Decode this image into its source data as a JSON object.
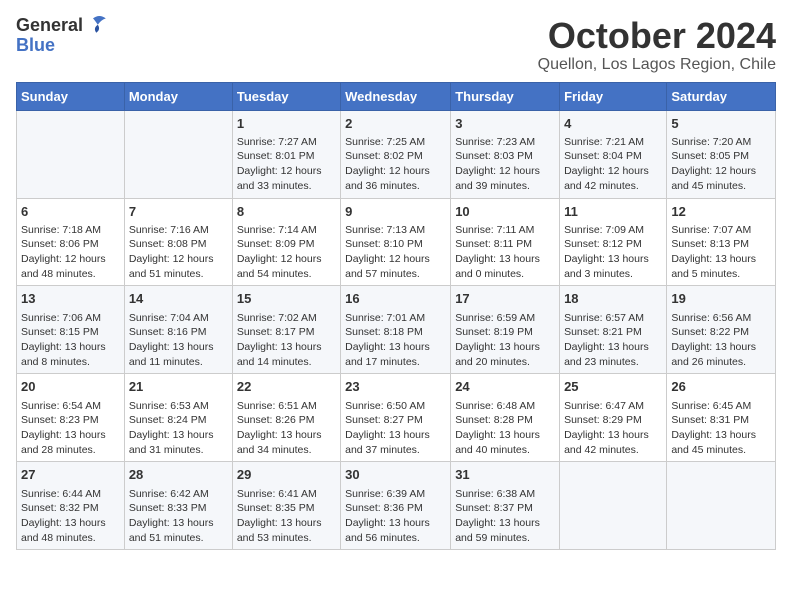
{
  "header": {
    "logo_general": "General",
    "logo_blue": "Blue",
    "title": "October 2024",
    "subtitle": "Quellon, Los Lagos Region, Chile"
  },
  "days_of_week": [
    "Sunday",
    "Monday",
    "Tuesday",
    "Wednesday",
    "Thursday",
    "Friday",
    "Saturday"
  ],
  "weeks": [
    [
      {
        "day": "",
        "content": ""
      },
      {
        "day": "",
        "content": ""
      },
      {
        "day": "1",
        "content": "Sunrise: 7:27 AM\nSunset: 8:01 PM\nDaylight: 12 hours and 33 minutes."
      },
      {
        "day": "2",
        "content": "Sunrise: 7:25 AM\nSunset: 8:02 PM\nDaylight: 12 hours and 36 minutes."
      },
      {
        "day": "3",
        "content": "Sunrise: 7:23 AM\nSunset: 8:03 PM\nDaylight: 12 hours and 39 minutes."
      },
      {
        "day": "4",
        "content": "Sunrise: 7:21 AM\nSunset: 8:04 PM\nDaylight: 12 hours and 42 minutes."
      },
      {
        "day": "5",
        "content": "Sunrise: 7:20 AM\nSunset: 8:05 PM\nDaylight: 12 hours and 45 minutes."
      }
    ],
    [
      {
        "day": "6",
        "content": "Sunrise: 7:18 AM\nSunset: 8:06 PM\nDaylight: 12 hours and 48 minutes."
      },
      {
        "day": "7",
        "content": "Sunrise: 7:16 AM\nSunset: 8:08 PM\nDaylight: 12 hours and 51 minutes."
      },
      {
        "day": "8",
        "content": "Sunrise: 7:14 AM\nSunset: 8:09 PM\nDaylight: 12 hours and 54 minutes."
      },
      {
        "day": "9",
        "content": "Sunrise: 7:13 AM\nSunset: 8:10 PM\nDaylight: 12 hours and 57 minutes."
      },
      {
        "day": "10",
        "content": "Sunrise: 7:11 AM\nSunset: 8:11 PM\nDaylight: 13 hours and 0 minutes."
      },
      {
        "day": "11",
        "content": "Sunrise: 7:09 AM\nSunset: 8:12 PM\nDaylight: 13 hours and 3 minutes."
      },
      {
        "day": "12",
        "content": "Sunrise: 7:07 AM\nSunset: 8:13 PM\nDaylight: 13 hours and 5 minutes."
      }
    ],
    [
      {
        "day": "13",
        "content": "Sunrise: 7:06 AM\nSunset: 8:15 PM\nDaylight: 13 hours and 8 minutes."
      },
      {
        "day": "14",
        "content": "Sunrise: 7:04 AM\nSunset: 8:16 PM\nDaylight: 13 hours and 11 minutes."
      },
      {
        "day": "15",
        "content": "Sunrise: 7:02 AM\nSunset: 8:17 PM\nDaylight: 13 hours and 14 minutes."
      },
      {
        "day": "16",
        "content": "Sunrise: 7:01 AM\nSunset: 8:18 PM\nDaylight: 13 hours and 17 minutes."
      },
      {
        "day": "17",
        "content": "Sunrise: 6:59 AM\nSunset: 8:19 PM\nDaylight: 13 hours and 20 minutes."
      },
      {
        "day": "18",
        "content": "Sunrise: 6:57 AM\nSunset: 8:21 PM\nDaylight: 13 hours and 23 minutes."
      },
      {
        "day": "19",
        "content": "Sunrise: 6:56 AM\nSunset: 8:22 PM\nDaylight: 13 hours and 26 minutes."
      }
    ],
    [
      {
        "day": "20",
        "content": "Sunrise: 6:54 AM\nSunset: 8:23 PM\nDaylight: 13 hours and 28 minutes."
      },
      {
        "day": "21",
        "content": "Sunrise: 6:53 AM\nSunset: 8:24 PM\nDaylight: 13 hours and 31 minutes."
      },
      {
        "day": "22",
        "content": "Sunrise: 6:51 AM\nSunset: 8:26 PM\nDaylight: 13 hours and 34 minutes."
      },
      {
        "day": "23",
        "content": "Sunrise: 6:50 AM\nSunset: 8:27 PM\nDaylight: 13 hours and 37 minutes."
      },
      {
        "day": "24",
        "content": "Sunrise: 6:48 AM\nSunset: 8:28 PM\nDaylight: 13 hours and 40 minutes."
      },
      {
        "day": "25",
        "content": "Sunrise: 6:47 AM\nSunset: 8:29 PM\nDaylight: 13 hours and 42 minutes."
      },
      {
        "day": "26",
        "content": "Sunrise: 6:45 AM\nSunset: 8:31 PM\nDaylight: 13 hours and 45 minutes."
      }
    ],
    [
      {
        "day": "27",
        "content": "Sunrise: 6:44 AM\nSunset: 8:32 PM\nDaylight: 13 hours and 48 minutes."
      },
      {
        "day": "28",
        "content": "Sunrise: 6:42 AM\nSunset: 8:33 PM\nDaylight: 13 hours and 51 minutes."
      },
      {
        "day": "29",
        "content": "Sunrise: 6:41 AM\nSunset: 8:35 PM\nDaylight: 13 hours and 53 minutes."
      },
      {
        "day": "30",
        "content": "Sunrise: 6:39 AM\nSunset: 8:36 PM\nDaylight: 13 hours and 56 minutes."
      },
      {
        "day": "31",
        "content": "Sunrise: 6:38 AM\nSunset: 8:37 PM\nDaylight: 13 hours and 59 minutes."
      },
      {
        "day": "",
        "content": ""
      },
      {
        "day": "",
        "content": ""
      }
    ]
  ]
}
